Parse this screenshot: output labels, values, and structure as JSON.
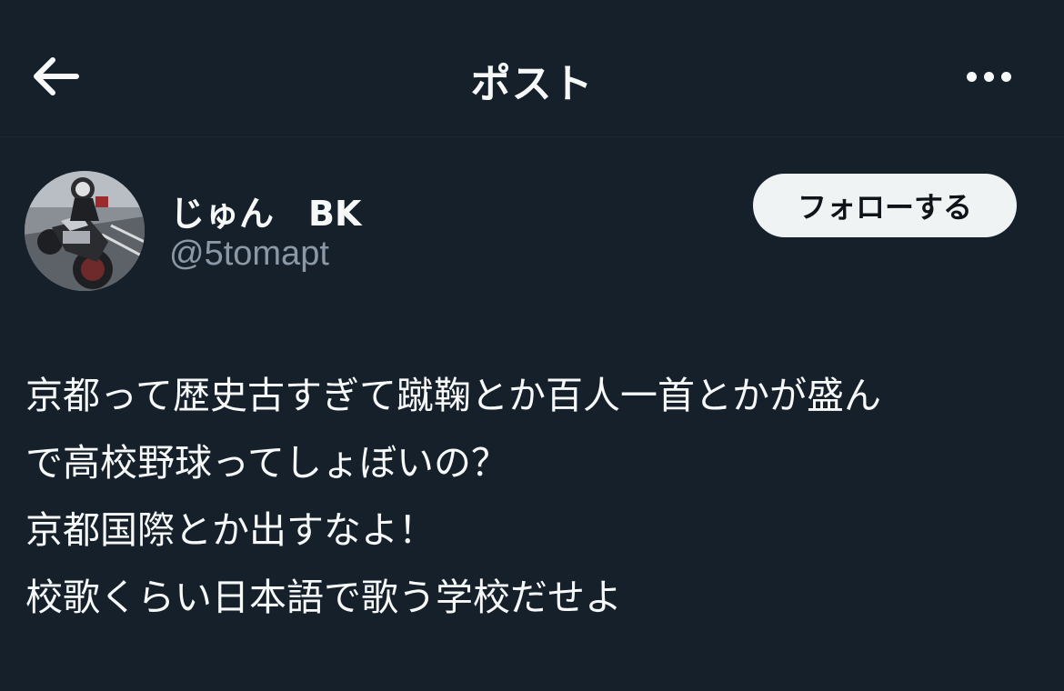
{
  "header": {
    "title": "ポスト",
    "back_icon": "arrow-left-icon",
    "more_icon": "more-horizontal-icon"
  },
  "author": {
    "display_name": "じゅん　BK",
    "handle": "@5tomapt",
    "avatar": "motorcycle-photo"
  },
  "follow_button": {
    "label": "フォローする"
  },
  "post": {
    "lines": [
      "京都って歴史古すぎて蹴鞠とか百人一首とかが盛ん",
      "で高校野球ってしょぼいの？",
      "京都国際とか出すなよ！",
      "校歌くらい日本語で歌う学校だせよ"
    ]
  },
  "colors": {
    "background": "#15202b",
    "text_primary": "#f7f9f9",
    "text_secondary": "#8b98a5",
    "button_bg": "#eff3f4",
    "button_text": "#0f1419"
  }
}
